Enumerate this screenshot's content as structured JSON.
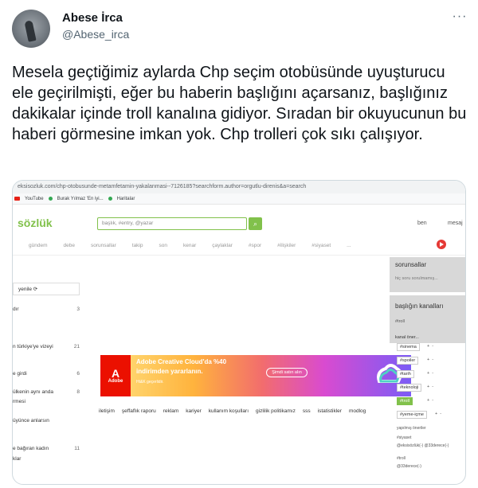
{
  "tweet": {
    "display_name": "Abese İrca",
    "handle": "@Abese_irca",
    "more_icon": "ellipsis-icon",
    "text": "Mesela geçtiğimiz aylarda Chp seçim otobüsünde uyuşturucu ele geçirilmişti, eğer bu haberin başlığını açarsanız, başlığınız dakikalar içinde troll kanalına gidiyor. Sıradan bir okuyucunun bu haberi görmesine imkan yok. Chp trolleri çok sıkı çalışıyor."
  },
  "screenshot": {
    "url": "eksisozluk.com/chp-otobusunde-metamfetamin-yakalanmasi--7126185?searchform.author=orgutlu-direnis&a=search",
    "bookmarks": [
      "YouTube",
      "Burak Yılmaz 'En iyi...",
      "Haritalar"
    ],
    "logo": "sözlük",
    "search_placeholder": "başlık, #entry, @yazar",
    "user_label": "ben",
    "messages_label": "mesaj",
    "nav": [
      "gündem",
      "debe",
      "sorunsallar",
      "takip",
      "son",
      "kenar",
      "çaylaklar",
      "#spor",
      "#ilişkiler",
      "#siyaset",
      "..."
    ],
    "refresh_label": "yenile",
    "left_items": [
      {
        "label": "dır",
        "count": "3"
      },
      {
        "label": "n türkiye'ye vizeyi",
        "count": "21"
      },
      {
        "label": "e girdi",
        "count": "6"
      },
      {
        "label": "ülkenin aynı anda",
        "count": "8"
      },
      {
        "label": "rmesi",
        "count": ""
      },
      {
        "label": "üyünce anlarsın",
        "count": ""
      },
      {
        "label": "e bağıran kadın",
        "count": "11"
      },
      {
        "label": "klar",
        "count": ""
      }
    ],
    "ad": {
      "brand": "Adobe",
      "line1": "Adobe Creative Cloud'da %40",
      "line2": "indirimden yararlanın.",
      "line3": "Ht&K geçerlidir.",
      "button": "Şimdi satın alın"
    },
    "footer": [
      "iletişim",
      "şeffaflık raporu",
      "reklam",
      "kariyer",
      "kullanım koşulları",
      "gizlilik politikamız",
      "sss",
      "istatistikler",
      "modlog"
    ],
    "sidebar": {
      "sorunsallar_title": "sorunsallar",
      "sorunsallar_sub": "hiç soru sorulmamış...",
      "kanallar_title": "başlığın kanalları",
      "current_channel": "#troll",
      "kanal_oner": "kanal öner...",
      "tags": [
        "#sinema",
        "#spoiler",
        "#tarih",
        "#teknoloji",
        "#troll",
        "#yeme-içme"
      ],
      "active_tag": "#troll",
      "plus": "+",
      "minus": "-",
      "yapilmis_label": "yapılmış öneriler",
      "yapilmis": [
        "#siyaset",
        "@eksisözlük(-)  @33derece(-)",
        "#troll",
        "@33derece(-)"
      ]
    }
  }
}
